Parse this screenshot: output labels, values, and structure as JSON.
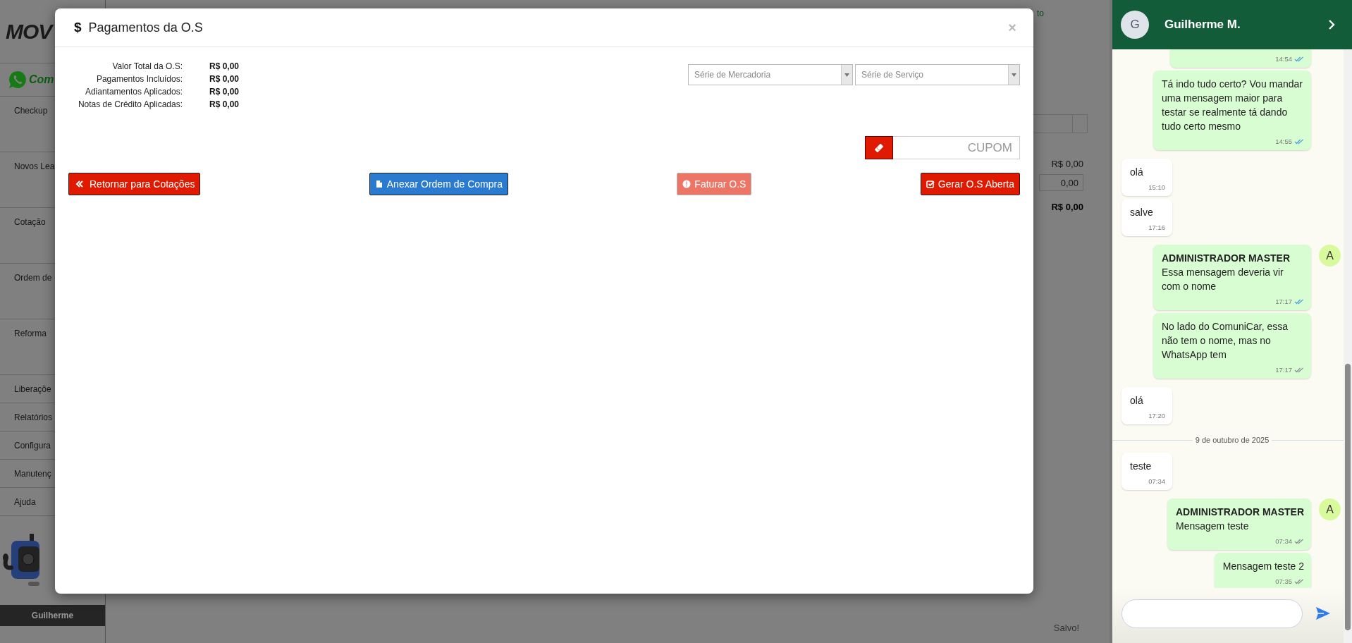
{
  "sidebar": {
    "logo_text": "MOV",
    "comunicar_text": "Com",
    "items": [
      {
        "label": "Checkup",
        "kind": "large"
      },
      {
        "label": "Novos Lea",
        "kind": "large"
      },
      {
        "label": "Cotação",
        "kind": "large"
      },
      {
        "label": "Ordem de",
        "kind": "large"
      },
      {
        "label": "Reforma",
        "kind": "large"
      },
      {
        "label": "Liberaçõe",
        "kind": "small"
      },
      {
        "label": "Relatórios",
        "kind": "small"
      },
      {
        "label": "Configura",
        "kind": "small"
      },
      {
        "label": "Manutenç",
        "kind": "small"
      },
      {
        "label": "Ajuda",
        "kind": "small"
      }
    ],
    "user": "Guilherme"
  },
  "background": {
    "top_link": "to",
    "subtotal": "R$ 0,00",
    "discount_value": "0,00",
    "total": "R$ 0,00",
    "status": "Salvo!"
  },
  "modal": {
    "title_icon": "$",
    "title": "Pagamentos da O.S",
    "close": "×",
    "summary": [
      {
        "label": "Valor Total da O.S:",
        "value": "R$ 0,00"
      },
      {
        "label": "Pagamentos Incluídos:",
        "value": "R$ 0,00"
      },
      {
        "label": "Adiantamentos Aplicados:",
        "value": "R$ 0,00"
      },
      {
        "label": "Notas de Crédito Aplicadas:",
        "value": "R$ 0,00"
      }
    ],
    "selects": [
      {
        "placeholder": "Série de Mercadoria"
      },
      {
        "placeholder": "Série de Serviço"
      }
    ],
    "coupon": {
      "placeholder": "CUPOM"
    },
    "buttons": [
      {
        "label": "Retornar para Cotações",
        "kind": "back",
        "disabled": false
      },
      {
        "label": "Anexar Ordem de Compra",
        "kind": "attach",
        "disabled": false
      },
      {
        "label": "Faturar O.S",
        "kind": "invoice",
        "disabled": true
      },
      {
        "label": "Gerar O.S Aberta",
        "kind": "generate",
        "disabled": false
      }
    ]
  },
  "chat": {
    "contact": {
      "initial": "G",
      "name": "Guilherme M."
    },
    "messages": [
      {
        "kind": "sent",
        "time": "14:54",
        "read": true
      },
      {
        "kind": "sent",
        "text": "Tá indo tudo certo? Vou mandar uma mensagem maior para testar se realmente tá dando tudo certo mesmo",
        "time": "14:55",
        "read": true
      },
      {
        "kind": "received",
        "text": "olá",
        "time": "15:10"
      },
      {
        "kind": "received",
        "text": "salve",
        "time": "17:16"
      },
      {
        "kind": "sent",
        "author": "ADMINISTRADOR MASTER",
        "avatar": "A",
        "text": "Essa mensagem deveria vir com o nome",
        "time": "17:17",
        "read": true
      },
      {
        "kind": "sent",
        "text": "No lado do ComuniCar, essa não tem o nome, mas no WhatsApp tem",
        "time": "17:17",
        "read": false
      },
      {
        "kind": "received",
        "text": "olá",
        "time": "17:20"
      },
      {
        "kind": "date",
        "text": "9 de outubro de 2025"
      },
      {
        "kind": "received",
        "text": "teste",
        "time": "07:34"
      },
      {
        "kind": "sent",
        "author": "ADMINISTRADOR MASTER",
        "avatar": "A",
        "text": "Mensagem teste",
        "time": "07:34",
        "read": false
      },
      {
        "kind": "sent",
        "text": "Mensagem teste 2",
        "time": "07:35",
        "read": false
      }
    ]
  }
}
